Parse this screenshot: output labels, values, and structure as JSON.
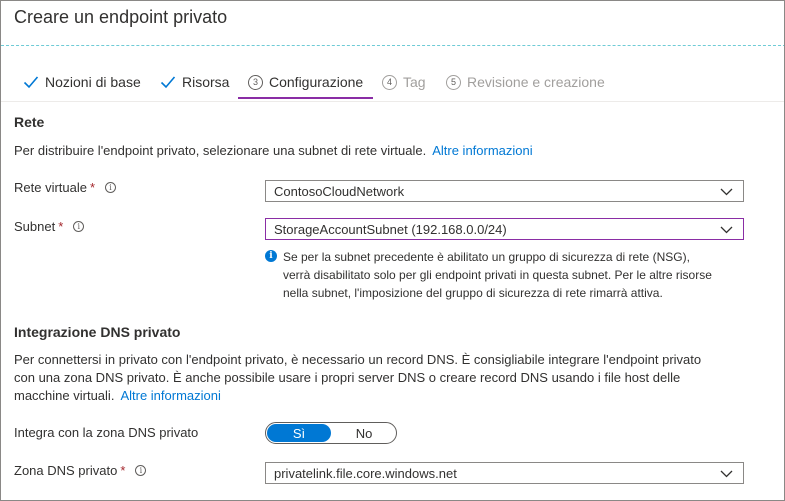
{
  "window": {
    "title": "Creare un endpoint privato"
  },
  "tabs": [
    {
      "label": "Nozioni di base",
      "state": "done"
    },
    {
      "label": "Risorsa",
      "state": "done"
    },
    {
      "number": "3",
      "label": "Configurazione",
      "state": "active"
    },
    {
      "number": "4",
      "label": "Tag",
      "state": "disabled"
    },
    {
      "number": "5",
      "label": "Revisione e creazione",
      "state": "disabled"
    }
  ],
  "network": {
    "title": "Rete",
    "description": "Per distribuire l'endpoint privato, selezionare una subnet di rete virtuale.",
    "link": "Altre informazioni",
    "virtual_network": {
      "label": "Rete virtuale",
      "required": "*",
      "value": "ContosoCloudNetwork"
    },
    "subnet": {
      "label": "Subnet",
      "required": "*",
      "value": "StorageAccountSubnet (192.168.0.0/24)"
    },
    "info_lines": [
      "Se per la subnet precedente è abilitato un gruppo di sicurezza di rete (NSG),",
      "verrà disabilitato solo per gli endpoint privati in questa subnet. Per le altre risorse",
      "nella subnet, l'imposizione del gruppo di sicurezza di rete rimarrà attiva."
    ]
  },
  "dns": {
    "title": "Integrazione DNS privato",
    "description_lines": [
      "Per connettersi in privato con l'endpoint privato, è necessario un record DNS. È consigliabile integrare l'endpoint privato",
      "con una zona DNS privato. È anche possibile usare i propri server DNS o creare record DNS usando i file host delle",
      "macchine virtuali."
    ],
    "link": "Altre informazioni",
    "integrate": {
      "label": "Integra con la zona DNS privato",
      "yes": "Sì",
      "no": "No",
      "selected": "yes"
    },
    "zone": {
      "label": "Zona DNS privato",
      "required": "*",
      "value": "privatelink.file.core.windows.net"
    }
  },
  "colors": {
    "accent": "#0078d4",
    "tab_active": "#8a2da5",
    "required": "#a4262c"
  }
}
